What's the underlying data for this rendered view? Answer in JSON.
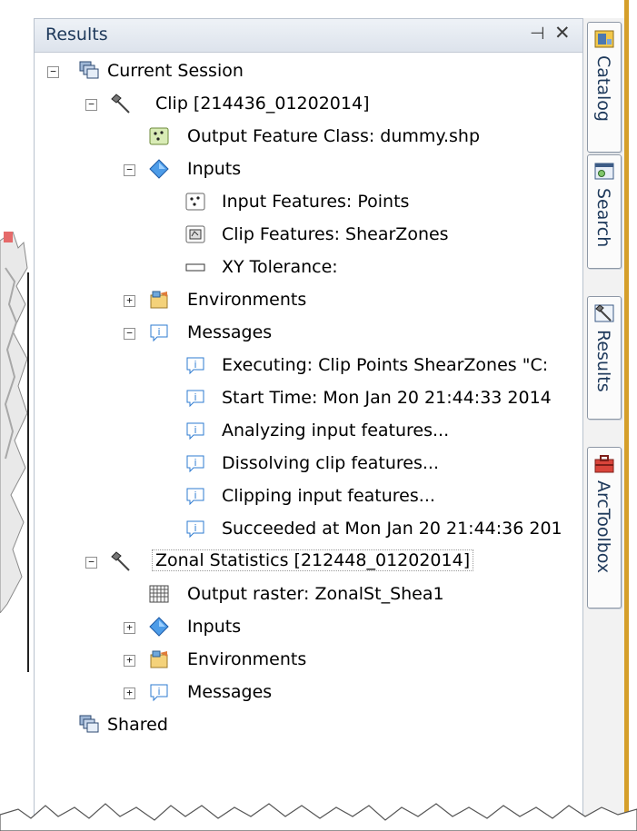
{
  "panel": {
    "title": "Results",
    "pin_glyph": "⊣",
    "close_glyph": "✕"
  },
  "tree": {
    "current_session": "Current Session",
    "clip": "Clip [214436_01202014]",
    "output_feature_class": "Output Feature Class: dummy.shp",
    "inputs": "Inputs",
    "input_features": "Input Features: Points",
    "clip_features": "Clip Features: ShearZones",
    "xy_tolerance": "XY Tolerance:",
    "environments": "Environments",
    "messages": "Messages",
    "msg_executing": "Executing: Clip Points ShearZones \"C:",
    "msg_start": "Start Time: Mon Jan 20 21:44:33 2014",
    "msg_analyzing": "Analyzing input features...",
    "msg_dissolving": "Dissolving clip features...",
    "msg_clipping": "Clipping input features...",
    "msg_succeeded": "Succeeded at Mon Jan 20 21:44:36 201",
    "zonal": "Zonal Statistics [212448_01202014]",
    "output_raster": "Output raster: ZonalSt_Shea1",
    "zonal_inputs": "Inputs",
    "zonal_environments": "Environments",
    "zonal_messages": "Messages",
    "shared": "Shared"
  },
  "expanders": {
    "minus": "−",
    "plus": "+"
  },
  "dock_tabs": [
    "Catalog",
    "Search",
    "Results",
    "ArcToolbox"
  ],
  "colors": {
    "title": "#1e395b",
    "accent": "#d59f2a",
    "info_blue": "#2e7bd1"
  }
}
